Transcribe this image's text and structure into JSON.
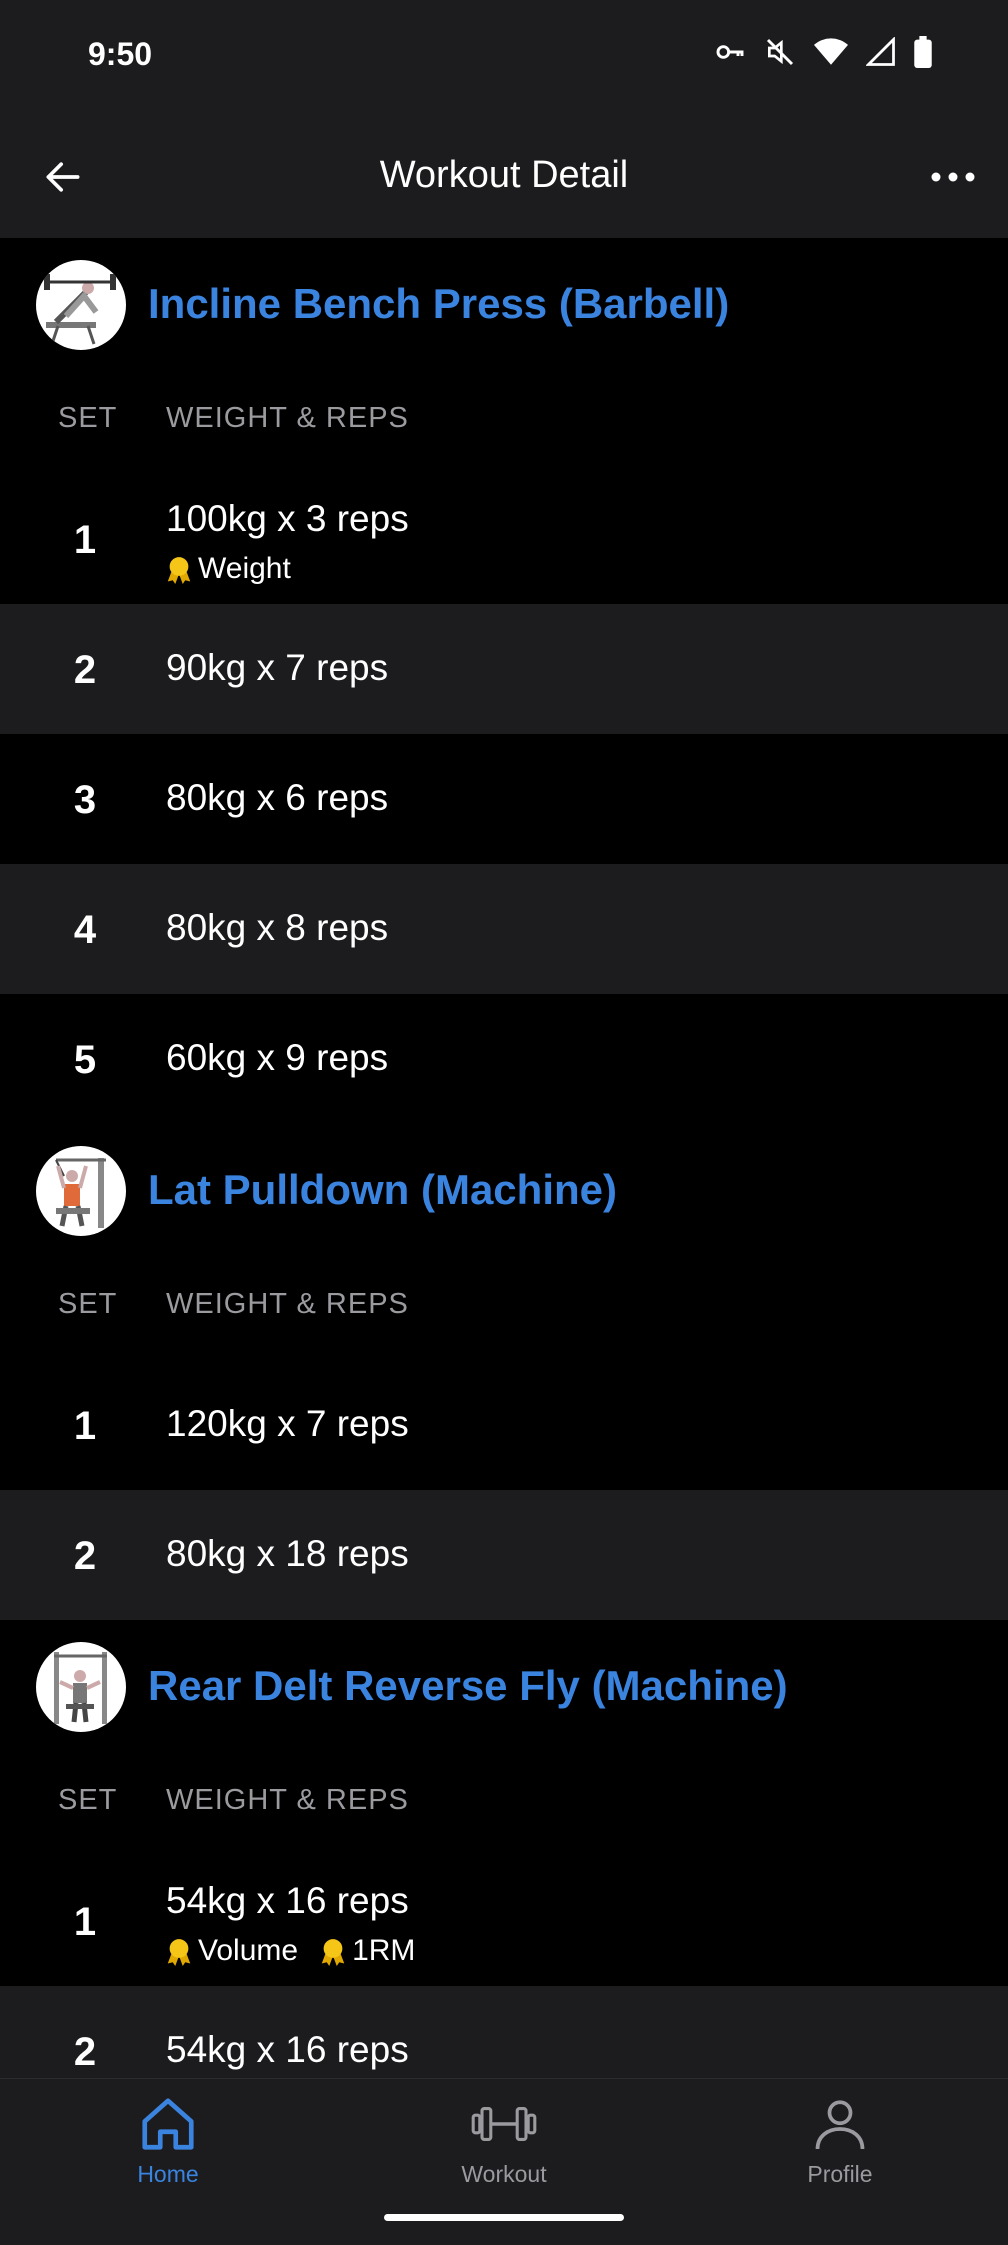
{
  "status_bar": {
    "time": "9:50"
  },
  "header": {
    "title": "Workout Detail"
  },
  "columns": {
    "set": "SET",
    "weight_reps": "WEIGHT & REPS"
  },
  "exercises": [
    {
      "name": "Incline Bench Press (Barbell)",
      "sets": [
        {
          "num": "1",
          "value": "100kg x 3 reps",
          "badges": [
            "Weight"
          ]
        },
        {
          "num": "2",
          "value": "90kg x 7 reps"
        },
        {
          "num": "3",
          "value": "80kg x 6 reps"
        },
        {
          "num": "4",
          "value": "80kg x 8 reps"
        },
        {
          "num": "5",
          "value": "60kg x 9 reps"
        }
      ]
    },
    {
      "name": "Lat Pulldown (Machine)",
      "sets": [
        {
          "num": "1",
          "value": "120kg x 7 reps"
        },
        {
          "num": "2",
          "value": "80kg x 18 reps"
        }
      ]
    },
    {
      "name": "Rear Delt Reverse Fly (Machine)",
      "sets": [
        {
          "num": "1",
          "value": "54kg x 16 reps",
          "badges": [
            "Volume",
            "1RM"
          ]
        },
        {
          "num": "2",
          "value": "54kg x 16 reps"
        }
      ]
    }
  ],
  "bottom_nav": {
    "items": [
      {
        "label": "Home",
        "icon": "home-icon",
        "active": true
      },
      {
        "label": "Workout",
        "icon": "dumbbell-icon",
        "active": false
      },
      {
        "label": "Profile",
        "icon": "person-icon",
        "active": false
      }
    ]
  },
  "colors": {
    "accent": "#3a84e0",
    "background": "#000000",
    "surface": "#1c1c1e",
    "muted": "#9a9a9f",
    "badge": "#f5c518"
  }
}
